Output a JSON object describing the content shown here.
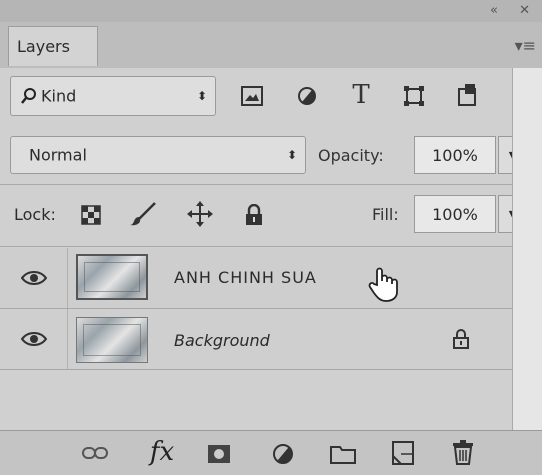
{
  "panel": {
    "tab_label": "Layers"
  },
  "filter": {
    "kind_label": "Kind"
  },
  "blend": {
    "mode": "Normal",
    "opacity_label": "Opacity:",
    "opacity_value": "100%"
  },
  "lock": {
    "label": "Lock:",
    "fill_label": "Fill:",
    "fill_value": "100%"
  },
  "layers": [
    {
      "name": "ANH CHINH SUA",
      "visible": true,
      "selected": true,
      "locked": false
    },
    {
      "name": "Background",
      "visible": true,
      "selected": false,
      "locked": true,
      "italic": true
    }
  ],
  "icons": {
    "filter": [
      "search-icon",
      "image-filter-icon",
      "adjustment-filter-icon",
      "type-filter-icon",
      "shape-filter-icon",
      "smart-object-filter-icon"
    ],
    "lock": [
      "lock-transparent-icon",
      "lock-image-icon",
      "lock-position-icon",
      "lock-all-icon"
    ],
    "bottom": [
      "link-layers-icon",
      "fx-icon",
      "add-mask-icon",
      "new-adjustment-icon",
      "new-group-icon",
      "new-layer-icon",
      "delete-icon"
    ]
  },
  "glyphs": {
    "fx": "fx",
    "type": "T"
  }
}
